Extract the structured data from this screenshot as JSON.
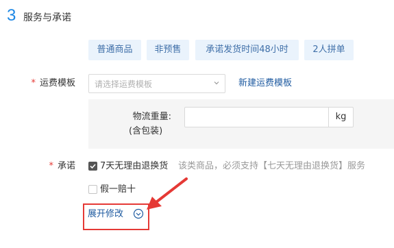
{
  "section": {
    "number": "3",
    "title": "服务与承诺"
  },
  "tags": [
    "普通商品",
    "非预售",
    "承诺发货时间48小时",
    "2人拼单"
  ],
  "shipping": {
    "label": "运费模板",
    "required_mark": "*",
    "select_placeholder": "请选择运费模板",
    "new_link": "新建运费模板"
  },
  "weight": {
    "label": "物流重量:",
    "sublabel": "(含包装)",
    "value": "",
    "unit": "kg"
  },
  "promise": {
    "label": "承诺",
    "required_mark": "*",
    "options": [
      {
        "label": "7天无理由退换货",
        "checked": true,
        "hint": "该类商品，必须支持【七天无理由退换货】服务"
      },
      {
        "label": "假一赔十",
        "checked": false
      }
    ],
    "expand_label": "展开修改"
  },
  "colors": {
    "accent": "#1e88e5",
    "link": "#1e5aa0",
    "highlight": "#e53935",
    "tag_bg": "#eaf3fc"
  }
}
